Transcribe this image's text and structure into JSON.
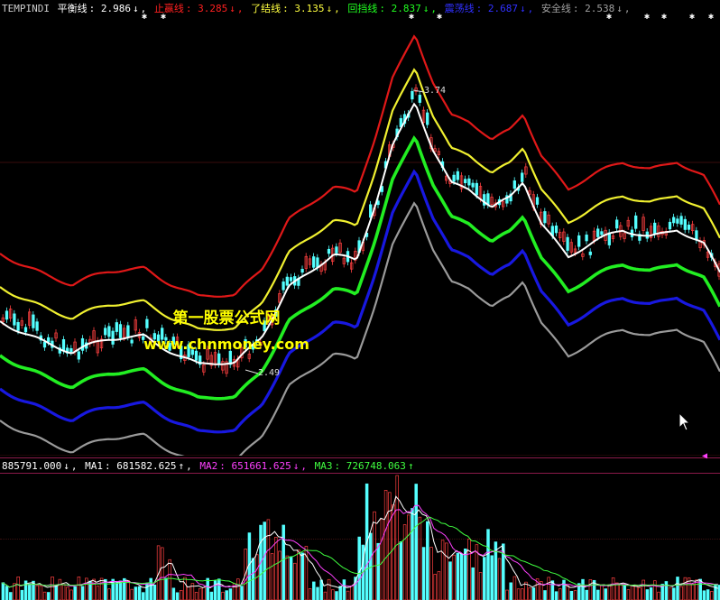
{
  "indicator": {
    "name": "TEMPINDI",
    "lines": [
      {
        "label": "平衡线",
        "value": "2.986",
        "arrow": "↓",
        "color": "#ffffff"
      },
      {
        "label": "止赢线",
        "value": "3.285",
        "arrow": "↓",
        "color": "#ff2020"
      },
      {
        "label": "了结线",
        "value": "3.135",
        "arrow": "↓",
        "color": "#ffff40"
      },
      {
        "label": "回挡线",
        "value": "2.837",
        "arrow": "↓",
        "color": "#20ff20"
      },
      {
        "label": "震荡线",
        "value": "2.687",
        "arrow": "↓",
        "color": "#3030ff"
      },
      {
        "label": "安全线",
        "value": "2.538",
        "arrow": "↓",
        "color": "#a0a0a0"
      }
    ]
  },
  "price_labels": {
    "high": "3.74",
    "low": "2.49"
  },
  "volume": {
    "vol": {
      "value": "885791.000",
      "arrow": "↓",
      "color": "#ffffff"
    },
    "ma": [
      {
        "label": "MA1",
        "value": "681582.625",
        "arrow": "↑",
        "color": "#ffffff"
      },
      {
        "label": "MA2",
        "value": "651661.625",
        "arrow": "↓",
        "color": "#ff40ff"
      },
      {
        "label": "MA3",
        "value": "726748.063",
        "arrow": "↑",
        "color": "#40ff40"
      }
    ]
  },
  "watermark": {
    "line1": "第一股票公式网",
    "line2": "www.chnmoney.com"
  },
  "marks": {
    "star": "✱",
    "triangle": "◀"
  },
  "colors": {
    "up": "#ff4040",
    "down": "#54ffff",
    "grid": "#8b1a4a"
  }
}
